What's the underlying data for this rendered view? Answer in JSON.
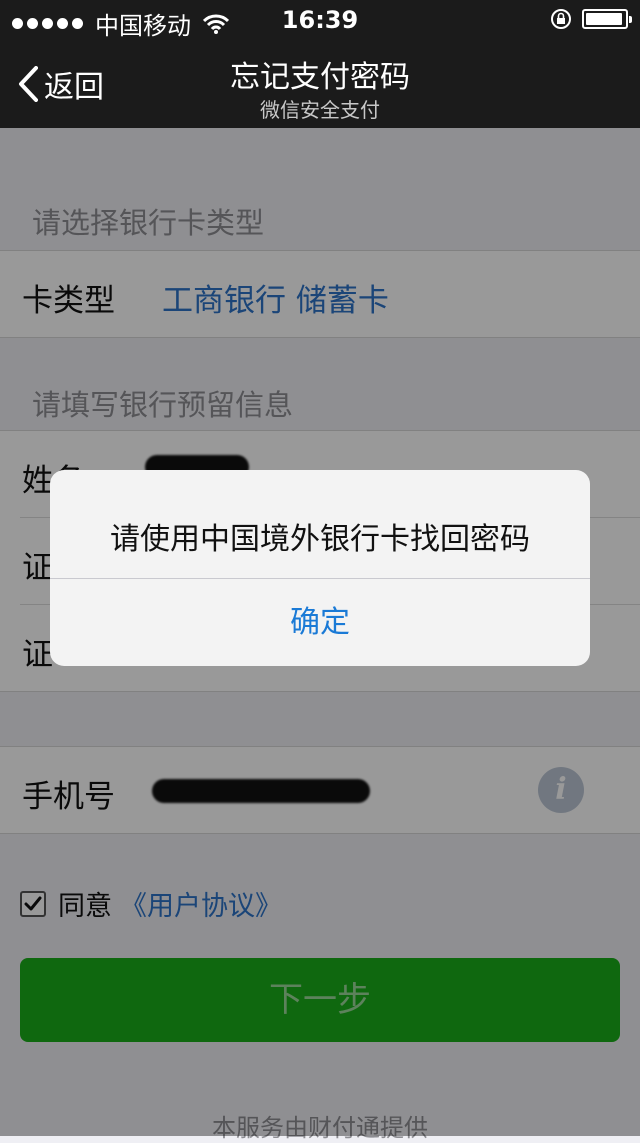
{
  "status_bar": {
    "carrier": "中国移动",
    "time": "16:39",
    "battery_level": 0.95
  },
  "nav": {
    "back_label": "返回",
    "title": "忘记支付密码",
    "subtitle": "微信安全支付"
  },
  "section_card": {
    "header": "请选择银行卡类型",
    "row_label": "卡类型",
    "row_value": "工商银行 储蓄卡"
  },
  "section_info": {
    "header": "请填写银行预留信息",
    "name_label": "姓名",
    "id_type_label": "证",
    "id_number_label": "证"
  },
  "phone": {
    "label": "手机号",
    "info_glyph": "i"
  },
  "agreement": {
    "checked": true,
    "agree_label": "同意",
    "link_label": "《用户协议》"
  },
  "next_button_label": "下一步",
  "footer": "本服务由财付通提供",
  "alert": {
    "message": "请使用中国境外银行卡找回密码",
    "confirm_label": "确定"
  },
  "colors": {
    "nav_background": "#1b1b1b",
    "link_blue": "#2d74c9",
    "button_green": "#1aad19",
    "alert_button_blue": "#1a7ad6"
  }
}
